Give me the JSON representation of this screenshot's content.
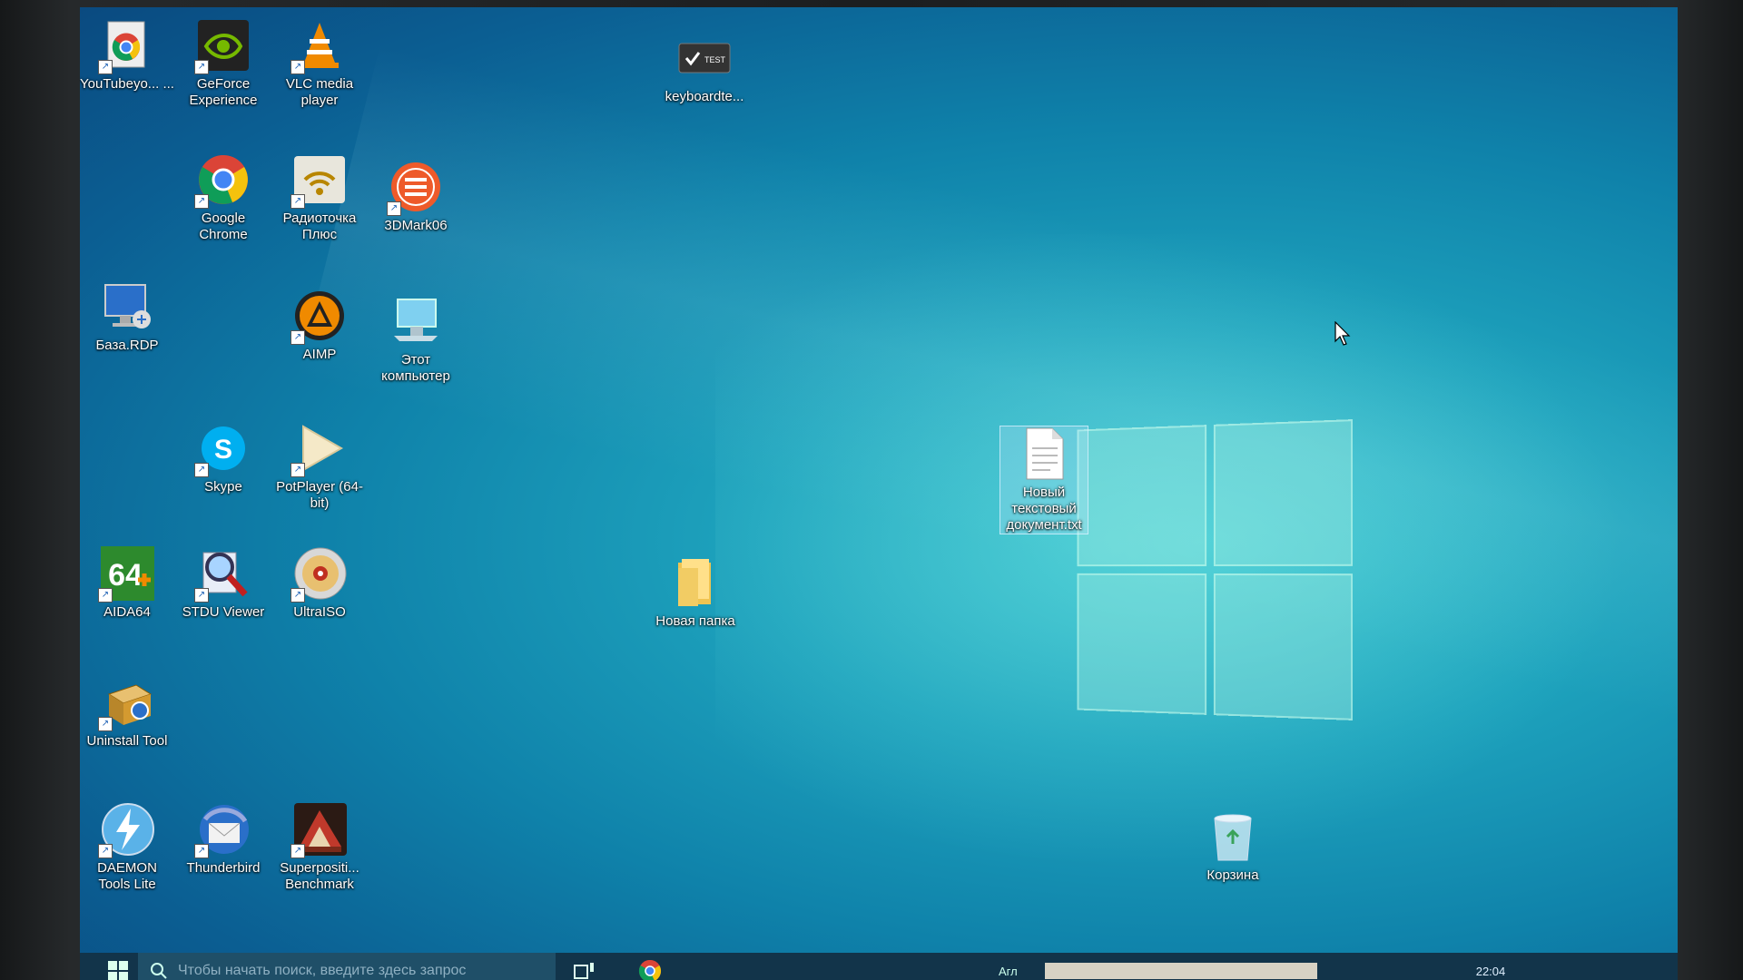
{
  "desktop": {
    "icons": [
      {
        "id": "youtube",
        "label": "YouTubeyo... ..."
      },
      {
        "id": "geforce",
        "label": "GeForce Experience"
      },
      {
        "id": "vlc",
        "label": "VLC media player"
      },
      {
        "id": "keyboardtest",
        "label": "keyboardte..."
      },
      {
        "id": "chrome",
        "label": "Google Chrome"
      },
      {
        "id": "radiotochka",
        "label": "Радиоточка Плюс"
      },
      {
        "id": "3dmark",
        "label": "3DMark06"
      },
      {
        "id": "basardp",
        "label": "База.RDP"
      },
      {
        "id": "aimp",
        "label": "AIMP"
      },
      {
        "id": "thispc",
        "label": "Этот компьютер"
      },
      {
        "id": "skype",
        "label": "Skype"
      },
      {
        "id": "potplayer",
        "label": "PotPlayer (64-bit)"
      },
      {
        "id": "textdoc",
        "label": "Новый текстовый документ.txt"
      },
      {
        "id": "aida64",
        "label": "AIDA64"
      },
      {
        "id": "stdu",
        "label": "STDU Viewer"
      },
      {
        "id": "ultraiso",
        "label": "UltraISO"
      },
      {
        "id": "newfolder",
        "label": "Новая папка"
      },
      {
        "id": "uninstall",
        "label": "Uninstall Tool"
      },
      {
        "id": "daemon",
        "label": "DAEMON Tools Lite"
      },
      {
        "id": "thunderbird",
        "label": "Thunderbird"
      },
      {
        "id": "superposition",
        "label": "Superpositi... Benchmark"
      },
      {
        "id": "recycle",
        "label": "Корзина"
      }
    ],
    "keyboardtest_badge": "TEST",
    "aida_badge": "64"
  },
  "taskbar": {
    "search_placeholder": "Чтобы начать поиск, введите здесь запрос",
    "lang": "Агл",
    "clock": "22:04"
  },
  "colors": {
    "taskbar": "#12344a",
    "wallpaper": "#1ea3bd"
  }
}
